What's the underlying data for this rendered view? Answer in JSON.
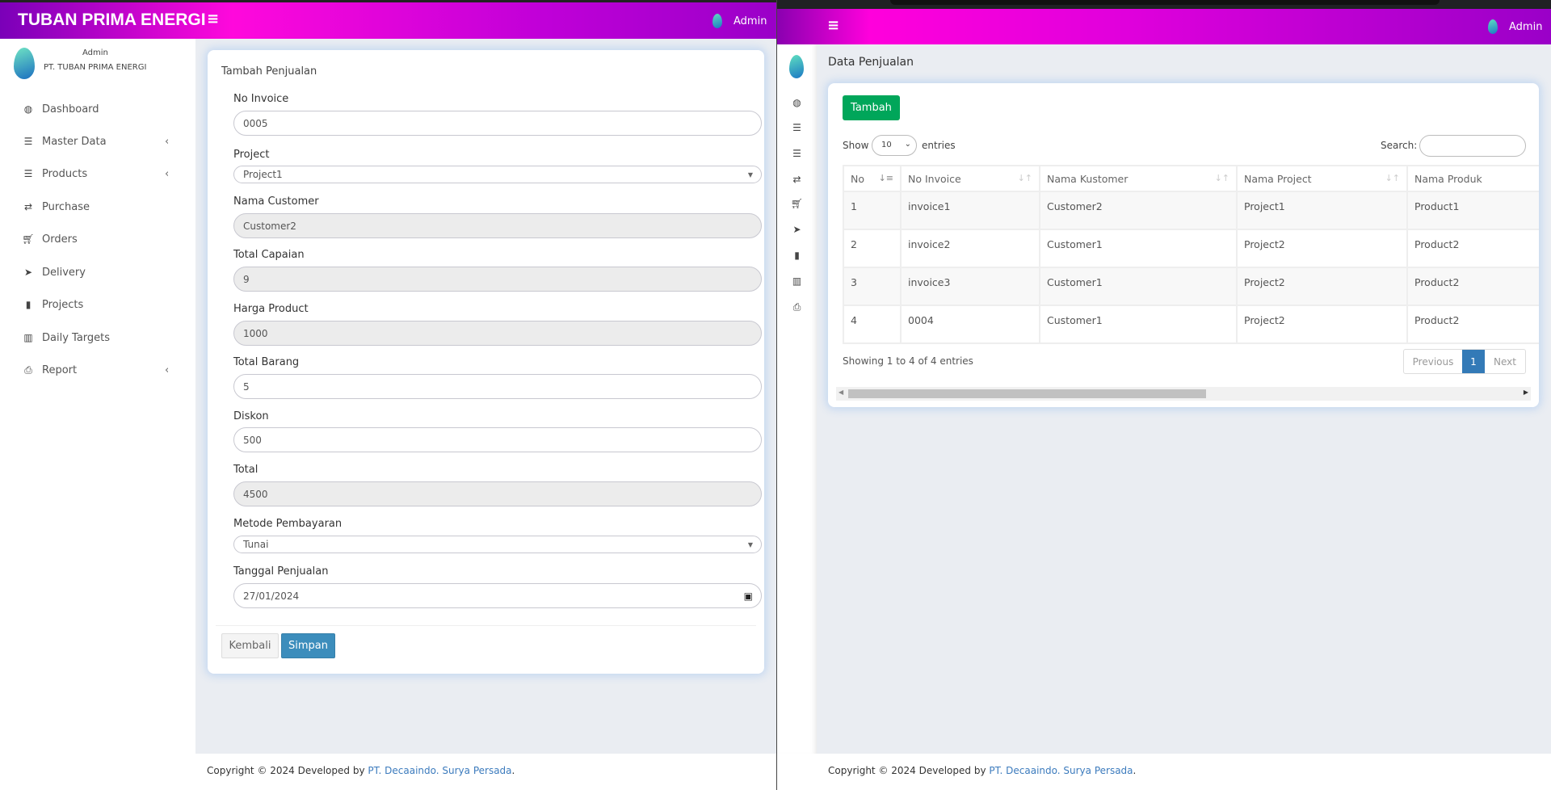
{
  "left_window": {
    "header": {
      "brand": "TUBAN PRIMA ENERGI",
      "menu_icon": "hamburger-icon",
      "user": "Admin"
    },
    "sidebar": {
      "user_name": "Admin",
      "company": "PT. TUBAN PRIMA ENERGI",
      "items": [
        {
          "label": "Dashboard",
          "icon": "dashboard-icon"
        },
        {
          "label": "Master Data",
          "icon": "server-icon",
          "has_submenu": true
        },
        {
          "label": "Products",
          "icon": "server-icon",
          "has_submenu": true
        },
        {
          "label": "Purchase",
          "icon": "exchange-icon"
        },
        {
          "label": "Orders",
          "icon": "cart-icon"
        },
        {
          "label": "Delivery",
          "icon": "paper-plane-icon"
        },
        {
          "label": "Projects",
          "icon": "bookmark-icon"
        },
        {
          "label": "Daily Targets",
          "icon": "bar-chart-icon"
        },
        {
          "label": "Report",
          "icon": "print-icon",
          "has_submenu": true
        }
      ]
    },
    "form": {
      "title": "Tambah Penjualan",
      "fields": [
        {
          "label": "No Invoice",
          "value": "0005"
        },
        {
          "label": "Project",
          "value": "Project1"
        },
        {
          "label": "Nama Customer",
          "value": "Customer2"
        },
        {
          "label": "Total Capaian",
          "value": "9"
        },
        {
          "label": "Harga Product",
          "value": "1000"
        },
        {
          "label": "Total Barang",
          "value": "5"
        },
        {
          "label": "Diskon",
          "value": "500"
        },
        {
          "label": "Total",
          "value": "4500"
        },
        {
          "label": "Metode Pembayaran",
          "value": "Tunai"
        },
        {
          "label": "Tanggal Penjualan",
          "value": "27/01/2024"
        }
      ],
      "back_label": "Kembali",
      "save_label": "Simpan"
    },
    "footer": {
      "text": "Copyright © 2024 Developed by ",
      "link": "PT. Decaaindo. Surya Persada",
      "end": "."
    }
  },
  "right_window": {
    "header": {
      "menu_icon": "hamburger-icon",
      "user": "Admin"
    },
    "page_title": "Data Penjualan",
    "add_label": "Tambah",
    "show_label": "Show",
    "entries_value": "10",
    "entries_label": "entries",
    "search_label": "Search:",
    "search_value": "",
    "table": {
      "columns": [
        "No",
        "No Invoice",
        "Nama Kustomer",
        "Nama Project",
        "Nama Produk"
      ],
      "rows": [
        [
          "1",
          "invoice1",
          "Customer2",
          "Project1",
          "Product1"
        ],
        [
          "2",
          "invoice2",
          "Customer1",
          "Project2",
          "Product2"
        ],
        [
          "3",
          "invoice3",
          "Customer1",
          "Project2",
          "Product2"
        ],
        [
          "4",
          "0004",
          "Customer1",
          "Project2",
          "Product2"
        ]
      ]
    },
    "info": "Showing 1 to 4 of 4 entries",
    "pagination": {
      "previous": "Previous",
      "current": "1",
      "next": "Next"
    },
    "footer": {
      "text": "Copyright © 2024 Developed by ",
      "link": "PT. Decaaindo. Surya Persada",
      "end": "."
    }
  },
  "colors": {
    "header_magenta": "#ff00dc",
    "header_purple": "#9a00c8",
    "add_button": "#00a65a",
    "save_button": "#3c8dbc",
    "link": "#3c7bbd"
  }
}
